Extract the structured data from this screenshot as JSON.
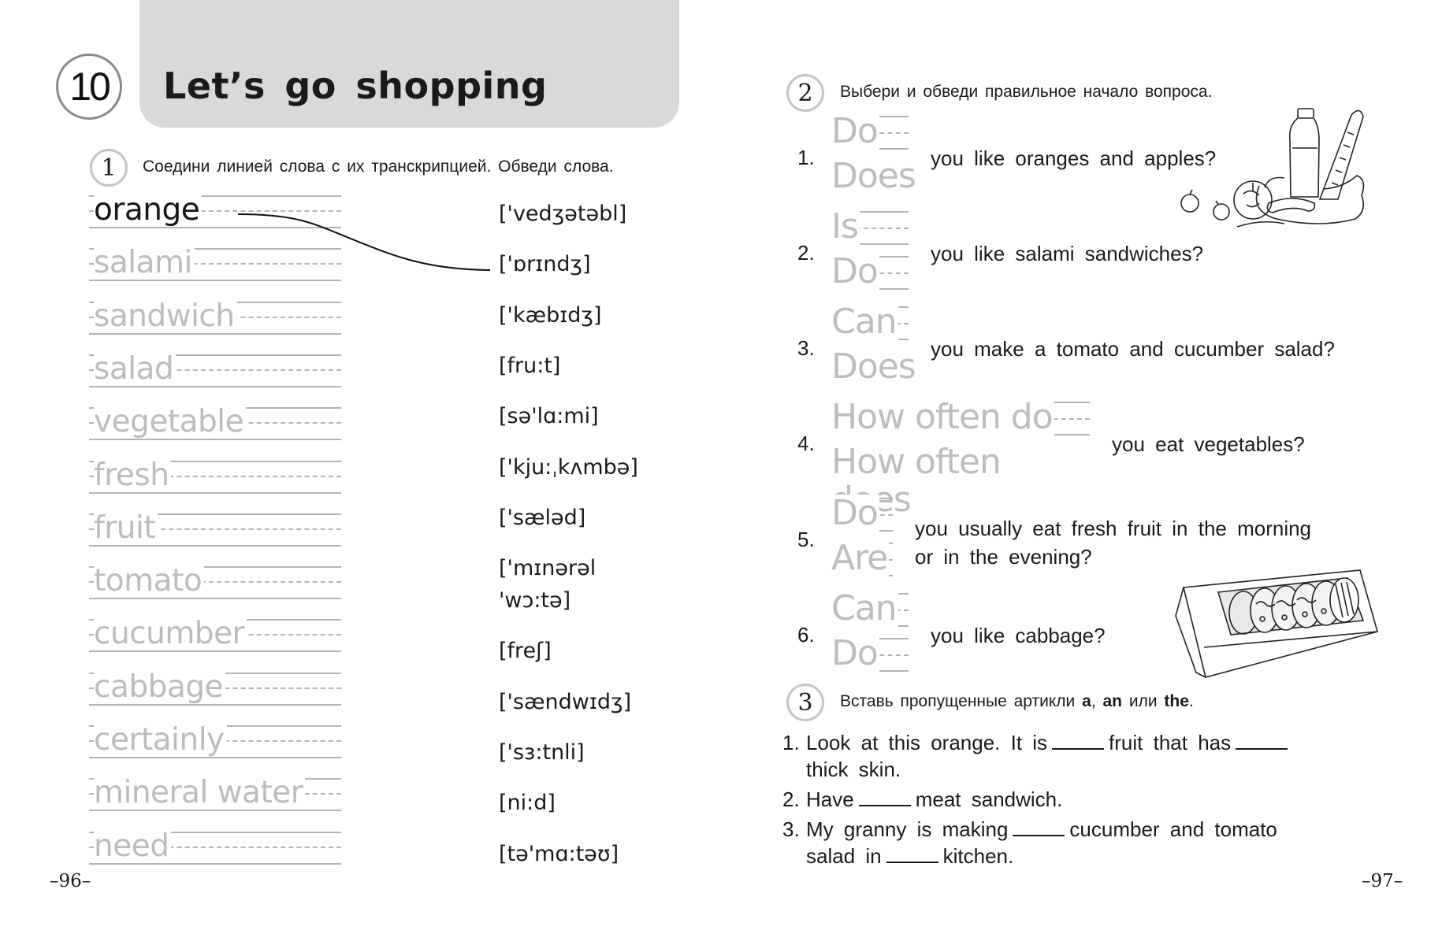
{
  "left_page": {
    "unit_number": "10",
    "unit_title": "Let’s go shopping",
    "page_number": "–96–",
    "exercise1": {
      "badge": "1",
      "instruction": "Соедини линией слова с их транскрипцией. Обведи слова.",
      "words": [
        {
          "text": "orange",
          "traced": true
        },
        {
          "text": "salami",
          "traced": false
        },
        {
          "text": "sandwich",
          "traced": false
        },
        {
          "text": "salad",
          "traced": false
        },
        {
          "text": "vegetable",
          "traced": false
        },
        {
          "text": "fresh",
          "traced": false
        },
        {
          "text": "fruit",
          "traced": false
        },
        {
          "text": "tomato",
          "traced": false
        },
        {
          "text": "cucumber",
          "traced": false
        },
        {
          "text": "cabbage",
          "traced": false
        },
        {
          "text": "certainly",
          "traced": false
        },
        {
          "text": "mineral water",
          "traced": false
        },
        {
          "text": "need",
          "traced": false
        }
      ],
      "transcriptions": [
        "['vedʒətəbl]",
        "['ɒrɪndʒ]",
        "['kæbɪdʒ]",
        "[fru:t]",
        "[sə'lɑ:mi]",
        "['kju:ˌkʌmbə]",
        "['sæləd]",
        "['mɪnərəl",
        "'wɔ:tə]",
        "[freʃ]",
        "['sændwɪdʒ]",
        "['sɜ:tnli]",
        "[ni:d]",
        "[tə'mɑ:təʊ]"
      ],
      "example_match": {
        "word": "orange",
        "transcription": "['ɒrɪndʒ]"
      }
    }
  },
  "right_page": {
    "page_number": "–97–",
    "exercise2": {
      "badge": "2",
      "instruction": "Выбери и обведи правильное начало вопроса.",
      "questions": [
        {
          "num": "1.",
          "options": [
            "Do",
            "Does"
          ],
          "text": "you like oranges and apples?"
        },
        {
          "num": "2.",
          "options": [
            "Is",
            "Do"
          ],
          "text": "you like salami sandwiches?"
        },
        {
          "num": "3.",
          "options": [
            "Can",
            "Does"
          ],
          "text": "you make a tomato and cucumber salad?"
        },
        {
          "num": "4.",
          "options": [
            "How often do",
            "How often does"
          ],
          "text": "you eat vegetables?"
        },
        {
          "num": "5.",
          "options": [
            "Do",
            "Are"
          ],
          "text_line1": "you usually eat fresh fruit in the morning",
          "text_line2": "or in the evening?"
        },
        {
          "num": "6.",
          "options": [
            "Can",
            "Do"
          ],
          "text": "you like cabbage?"
        }
      ],
      "illustrations": [
        "shopping-bag-illustration",
        "cookie-box-illustration"
      ]
    },
    "exercise3": {
      "badge": "3",
      "instruction_prefix": "Вставь пропущенные артикли ",
      "article_a": "a",
      "sep1": ", ",
      "article_an": "an",
      "sep2": " или ",
      "article_the": "the",
      "instruction_suffix": ".",
      "items": [
        {
          "num": "1.",
          "parts": [
            "Look at this orange. It is",
            "fruit that has",
            ""
          ],
          "cont": "thick skin."
        },
        {
          "num": "2.",
          "parts": [
            "Have",
            "meat sandwich."
          ]
        },
        {
          "num": "3.",
          "parts": [
            "My granny is making",
            "cucumber and tomato"
          ],
          "cont_parts": [
            "salad in",
            "kitchen."
          ]
        }
      ]
    }
  }
}
